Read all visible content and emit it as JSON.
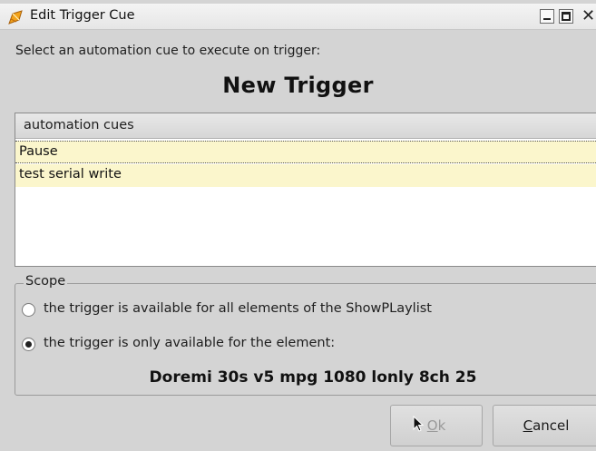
{
  "window": {
    "title": "Edit Trigger Cue",
    "icon": "app-icon",
    "controls": [
      "minimize-icon",
      "maximize-icon",
      "close-icon"
    ]
  },
  "dialog": {
    "prompt": "Select an automation cue to execute on trigger:",
    "heading": "New Trigger"
  },
  "cue_list": {
    "header": "automation cues",
    "items": [
      "Pause",
      "test serial write"
    ],
    "row_color": "#fbf6cc"
  },
  "scope": {
    "legend": "Scope",
    "options": [
      {
        "label": "the trigger is available for all elements of the ShowPLaylist",
        "checked": false
      },
      {
        "label": "the trigger is only available for the element:",
        "checked": true
      }
    ],
    "element_name": "Doremi 30s v5 mpg 1080 lonly 8ch 25"
  },
  "buttons": {
    "ok_mnemonic": "O",
    "ok_rest": "k",
    "ok_enabled": false,
    "cancel_mnemonic": "C",
    "cancel_rest": "ancel"
  }
}
